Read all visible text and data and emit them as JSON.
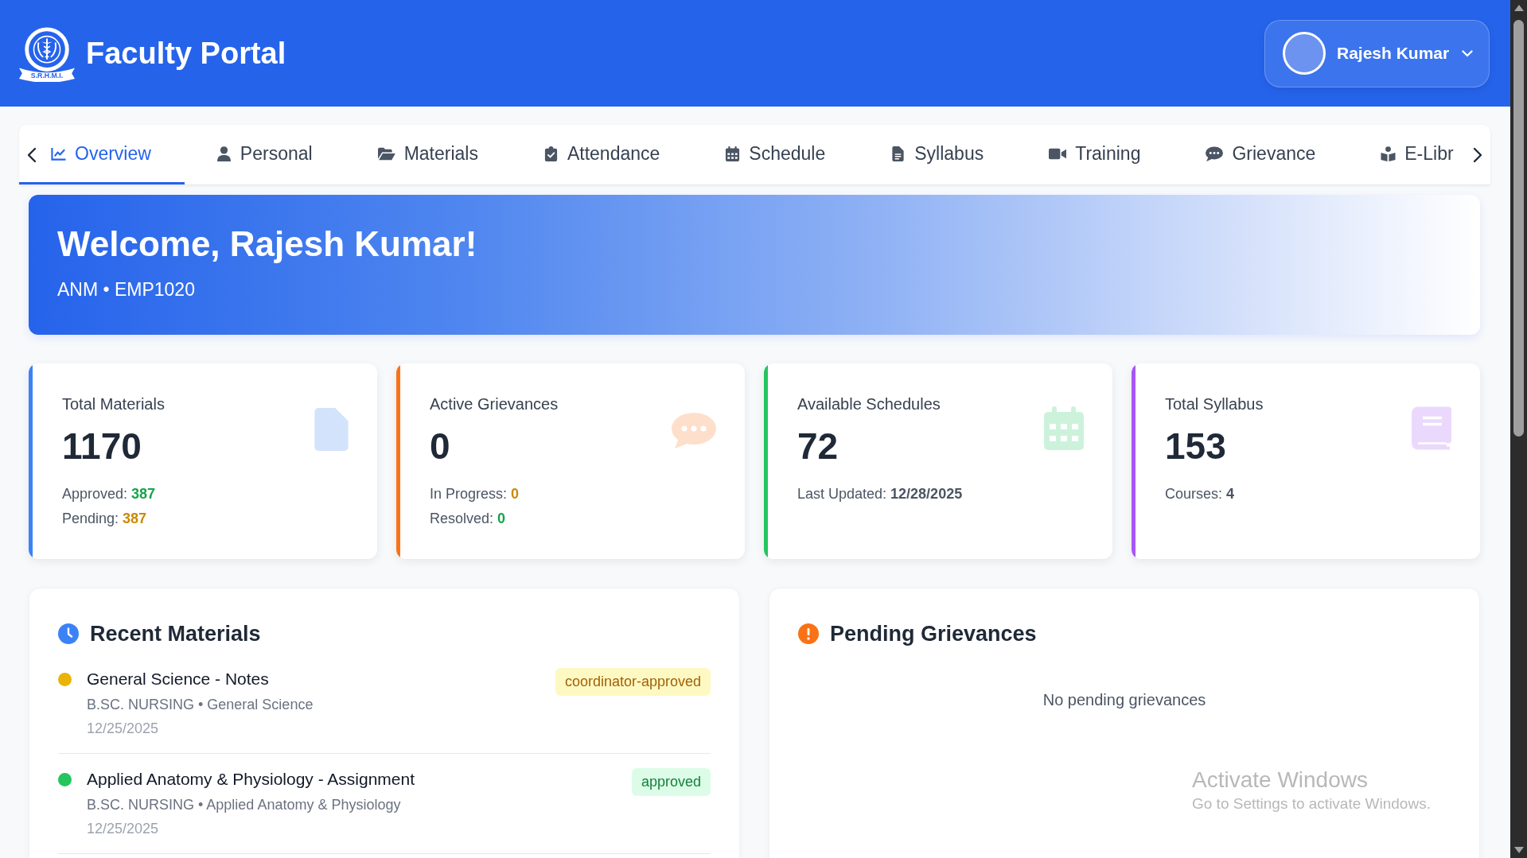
{
  "header": {
    "title": "Faculty Portal",
    "logo_text": "S.R.H.M.I.",
    "user": {
      "name": "Rajesh Kumar"
    }
  },
  "tabs": [
    {
      "label": "Overview",
      "selected": true
    },
    {
      "label": "Personal",
      "selected": false
    },
    {
      "label": "Materials",
      "selected": false
    },
    {
      "label": "Attendance",
      "selected": false
    },
    {
      "label": "Schedule",
      "selected": false
    },
    {
      "label": "Syllabus",
      "selected": false
    },
    {
      "label": "Training",
      "selected": false
    },
    {
      "label": "Grievance",
      "selected": false
    },
    {
      "label": "E-Libr",
      "selected": false
    }
  ],
  "welcome": {
    "title": "Welcome, Rajesh Kumar!",
    "subtitle": "ANM • EMP1020"
  },
  "stats": [
    {
      "label": "Total Materials",
      "value": "1170",
      "color": "#3b82f6",
      "details": [
        {
          "label": "Approved:",
          "value": "387",
          "color": "#16a34a"
        },
        {
          "label": "Pending:",
          "value": "387",
          "color": "#ca8a04"
        }
      ]
    },
    {
      "label": "Active Grievances",
      "value": "0",
      "color": "#f97316",
      "details": [
        {
          "label": "In Progress:",
          "value": "0",
          "color": "#ca8a04"
        },
        {
          "label": "Resolved:",
          "value": "0",
          "color": "#16a34a"
        }
      ]
    },
    {
      "label": "Available Schedules",
      "value": "72",
      "color": "#22c55e",
      "details": [
        {
          "label": "Last Updated:",
          "value": "12/28/2025",
          "color": "#4b5563"
        }
      ]
    },
    {
      "label": "Total Syllabus",
      "value": "153",
      "color": "#a855f7",
      "details": [
        {
          "label": "Courses:",
          "value": "4",
          "color": "#4b5563"
        }
      ]
    }
  ],
  "recent_materials": {
    "title": "Recent Materials",
    "items": [
      {
        "title": "General Science - Notes",
        "meta": "B.SC. NURSING • General Science",
        "date": "12/25/2025",
        "status": "coordinator-approved",
        "kind": "warning",
        "color": "#eab308"
      },
      {
        "title": "Applied Anatomy & Physiology - Assignment",
        "meta": "B.SC. NURSING • Applied Anatomy & Physiology",
        "date": "12/25/2025",
        "status": "approved",
        "kind": "success",
        "color": "#22c55e"
      }
    ]
  },
  "pending_grievances": {
    "title": "Pending Grievances",
    "empty_text": "No pending grievances"
  },
  "os_notice": {
    "title": "Activate Windows",
    "subtitle": "Go to Settings to activate Windows."
  }
}
